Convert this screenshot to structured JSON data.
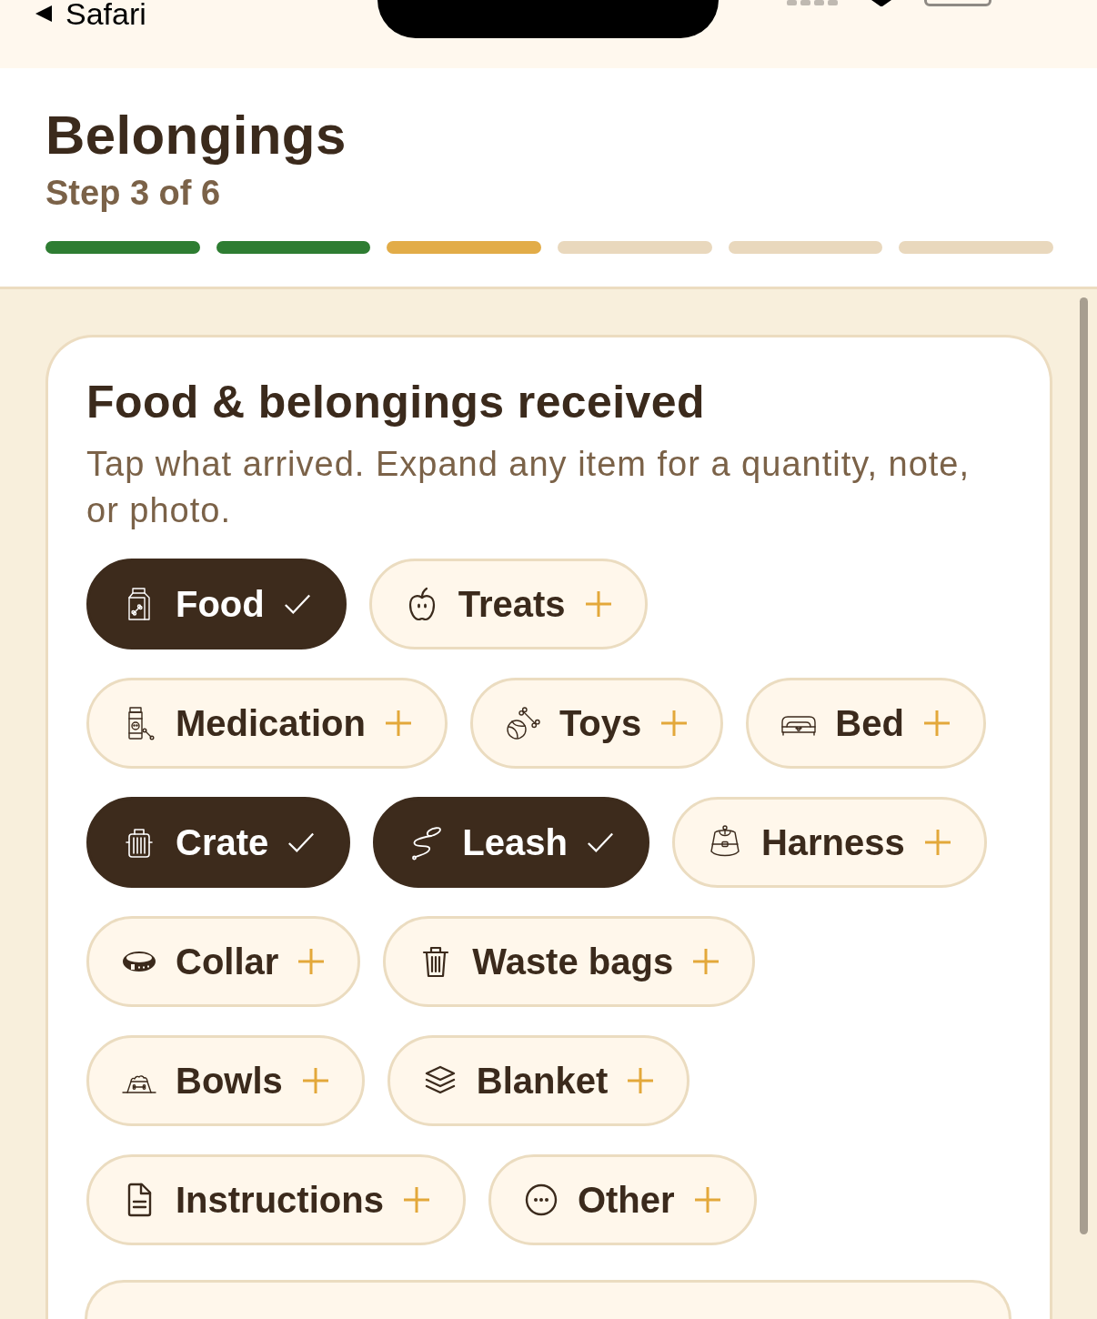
{
  "status_bar": {
    "back_label": "Safari"
  },
  "header": {
    "title": "Belongings",
    "step": "Step 3 of 6",
    "progress": [
      {
        "color": "#2e7d32"
      },
      {
        "color": "#2e7d32"
      },
      {
        "color": "#e2ac48"
      },
      {
        "color": "#e9d8bd"
      },
      {
        "color": "#e9d8bd"
      },
      {
        "color": "#e9d8bd"
      }
    ]
  },
  "card": {
    "title": "Food & belongings received",
    "description": "Tap what arrived. Expand any item for a quantity, note, or photo.",
    "chips": [
      {
        "label": "Food",
        "selected": true
      },
      {
        "label": "Treats",
        "selected": false
      },
      {
        "label": "Medication",
        "selected": false
      },
      {
        "label": "Toys",
        "selected": false
      },
      {
        "label": "Bed",
        "selected": false
      },
      {
        "label": "Crate",
        "selected": true
      },
      {
        "label": "Leash",
        "selected": true
      },
      {
        "label": "Harness",
        "selected": false
      },
      {
        "label": "Collar",
        "selected": false
      },
      {
        "label": "Waste bags",
        "selected": false
      },
      {
        "label": "Bowls",
        "selected": false
      },
      {
        "label": "Blanket",
        "selected": false
      },
      {
        "label": "Instructions",
        "selected": false
      },
      {
        "label": "Other",
        "selected": false
      }
    ]
  }
}
